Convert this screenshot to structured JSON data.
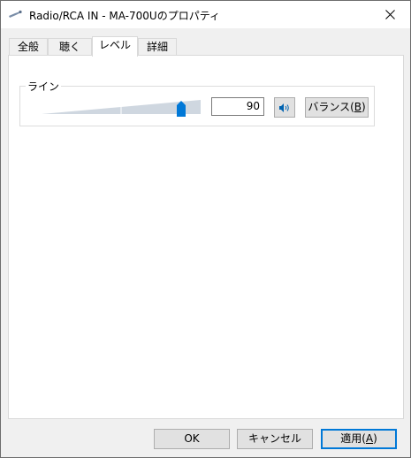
{
  "window": {
    "title": "Radio/RCA IN - MA-700Uのプロパティ"
  },
  "tabs": [
    {
      "label": "全般",
      "selected": false
    },
    {
      "label": "聴く",
      "selected": false
    },
    {
      "label": "レベル",
      "selected": true
    },
    {
      "label": "詳細",
      "selected": false
    }
  ],
  "level": {
    "group_label": "ライン",
    "value": "90",
    "slider_level_percent": 90,
    "balance_label": "バランス(",
    "balance_key": "B",
    "balance_suffix": ")"
  },
  "footer": {
    "ok_label": "OK",
    "cancel_label": "キャンセル",
    "apply_label": "適用(",
    "apply_key": "A",
    "apply_suffix": ")"
  },
  "colors": {
    "accent": "#0078d7",
    "slider_track": "#cfd7e0"
  },
  "icons": {
    "title": "audio-jack-icon",
    "close": "close-icon",
    "speaker": "speaker-icon"
  }
}
